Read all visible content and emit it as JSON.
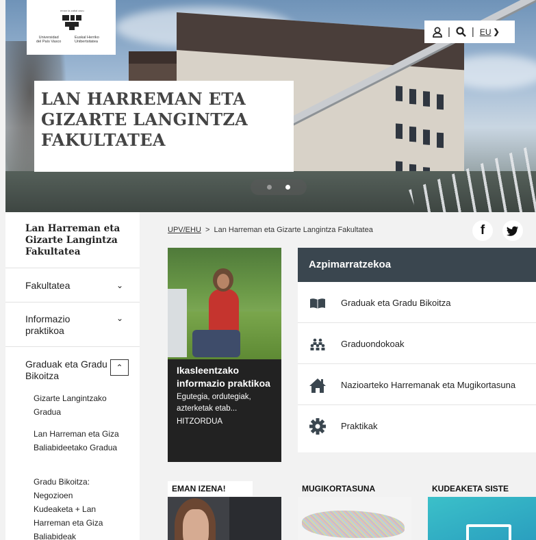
{
  "header": {
    "logo": {
      "tagline": "eman ta zabal zazu",
      "left_lines": [
        "Universidad",
        "del País Vasco"
      ],
      "right_lines": [
        "Euskal Herriko",
        "Unibertsitatea"
      ]
    },
    "title_lines": [
      "LAN HARREMAN ETA",
      "GIZARTE LANGINTZA",
      "FAKULTATEA"
    ],
    "tools": {
      "user_icon": "user-icon",
      "search_icon": "search-icon",
      "language": "EU",
      "separator": "|"
    },
    "slider": {
      "slides": 2,
      "active": 2
    }
  },
  "sidebar": {
    "title": "Lan Harreman eta Gizarte Langintza Fakultatea",
    "items": [
      {
        "label": "Fakultatea",
        "expanded": false
      },
      {
        "label": "Informazio praktikoa",
        "expanded": false
      },
      {
        "label": "Graduak eta Gradu Bikoitza",
        "expanded": true
      }
    ],
    "subitems": [
      "Gizarte Langintzako Gradua",
      "Lan Harreman eta Giza Baliabideetako Gradua",
      "Gradu Bikoitza: Negozioen Kudeaketa + Lan Harreman eta Giza Baliabideak"
    ]
  },
  "breadcrumb": {
    "root": "UPV/EHU",
    "separator": ">",
    "current": "Lan Harreman eta Gizarte Langintza Fakultatea"
  },
  "social": {
    "facebook": "f",
    "twitter": "twitter-icon"
  },
  "card": {
    "title": "Ikasleentzako informazio praktikoa",
    "description": "Egutegia, ordutegiak, azterketak etab...",
    "link": "HITZORDUA"
  },
  "panel": {
    "title": "Azpimarratzekoa",
    "items": [
      {
        "label": "Graduak eta Gradu Bikoitza",
        "icon": "book-icon"
      },
      {
        "label": "Graduondokoak",
        "icon": "people-icon"
      },
      {
        "label": "Nazioarteko Harremanak eta Mugikortasuna",
        "icon": "home-icon"
      },
      {
        "label": "Praktikak",
        "icon": "gear-icon"
      }
    ]
  },
  "tiles": [
    {
      "label": "EMAN IZENA!"
    },
    {
      "label": "MUGIKORTASUNA"
    },
    {
      "label": "KUDEAKETA SISTE"
    }
  ],
  "colors": {
    "panel_header": "#3a464f",
    "card_bg": "#222222",
    "tile_teal": "#2fb0c4"
  }
}
